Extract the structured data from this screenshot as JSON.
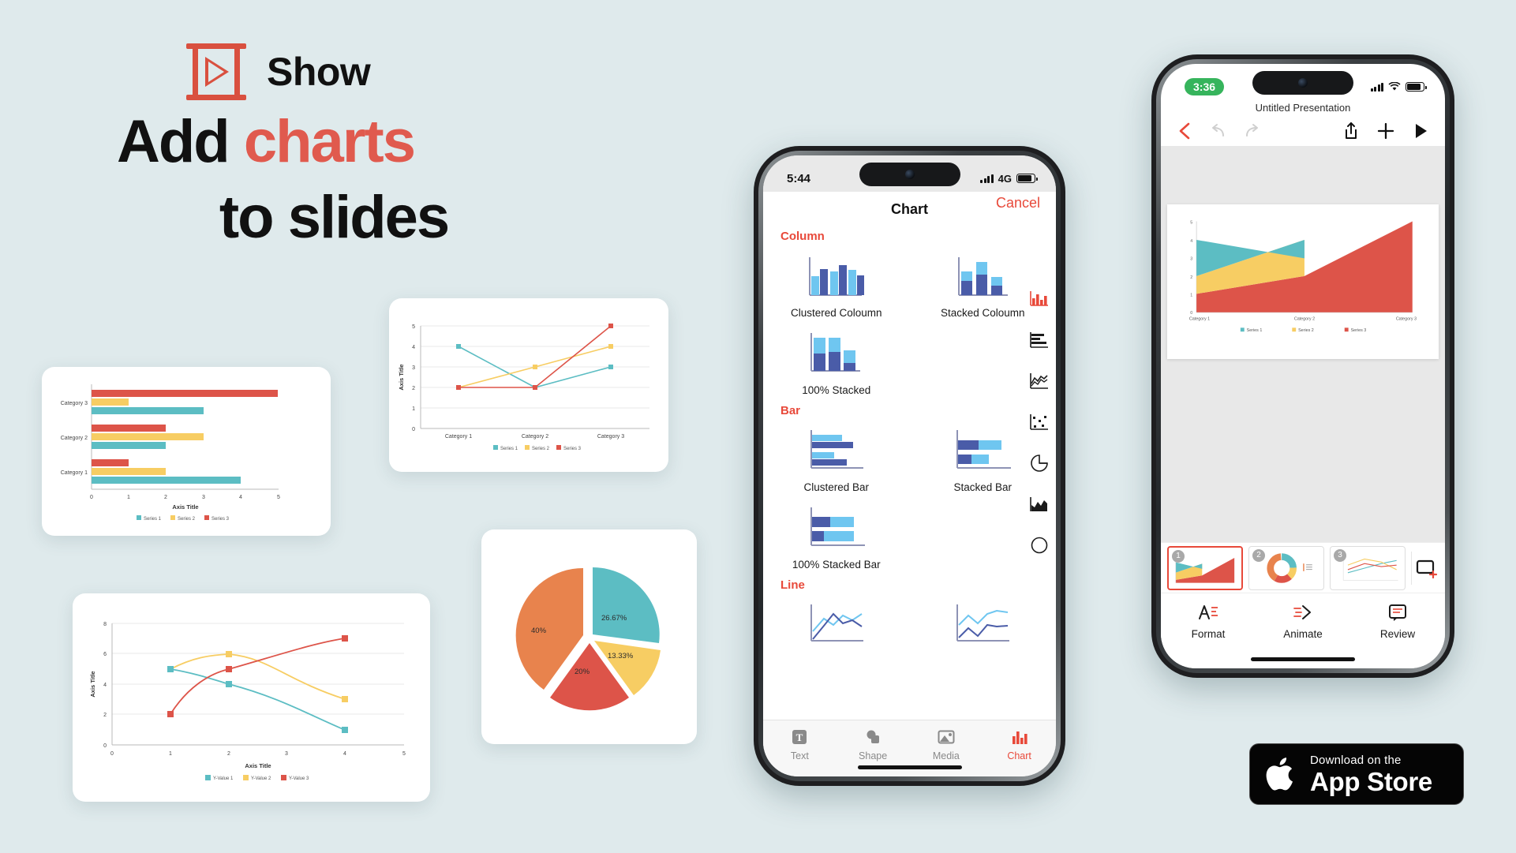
{
  "brand": {
    "name": "Show",
    "logo_icon": "projector-play-icon"
  },
  "headline": {
    "line1_black": "Add ",
    "line1_accent": "charts",
    "line2": "to slides"
  },
  "colors": {
    "accent_red": "#e05a4e",
    "teal": "#5cbdc3",
    "yellow": "#f7cd63",
    "red": "#dd5449",
    "orange": "#e8834d",
    "background": "#dfeaec"
  },
  "chart_data": [
    {
      "id": "clustered-bar-card",
      "type": "bar",
      "orientation": "horizontal",
      "title": "",
      "xlabel": "Axis Title",
      "ylabel": "",
      "categories": [
        "Category 1",
        "Category 2",
        "Category 3"
      ],
      "series": [
        {
          "name": "Series 1",
          "color": "#5cbdc3",
          "values": [
            4,
            2,
            3
          ]
        },
        {
          "name": "Series 2",
          "color": "#f7cd63",
          "values": [
            2,
            3,
            1
          ]
        },
        {
          "name": "Series 3",
          "color": "#dd5449",
          "values": [
            1,
            2,
            5
          ]
        }
      ],
      "xlim": [
        0,
        5
      ],
      "xticks": [
        "0",
        "1",
        "2",
        "3",
        "4",
        "5"
      ],
      "legend": "bottom",
      "grid": false
    },
    {
      "id": "line-card",
      "type": "line",
      "title": "",
      "xlabel": "",
      "ylabel": "Axis Title",
      "categories": [
        "Category 1",
        "Category 2",
        "Category 3"
      ],
      "series": [
        {
          "name": "Series 1",
          "color": "#5cbdc3",
          "values": [
            4,
            2,
            3
          ]
        },
        {
          "name": "Series 2",
          "color": "#f7cd63",
          "values": [
            2,
            3,
            4
          ]
        },
        {
          "name": "Series 3",
          "color": "#dd5449",
          "values": [
            2,
            2,
            5
          ]
        }
      ],
      "ylim": [
        0,
        5
      ],
      "yticks": [
        "0",
        "1",
        "2",
        "3",
        "4",
        "5"
      ],
      "legend": "bottom",
      "grid": true
    },
    {
      "id": "scatter-smooth-card",
      "type": "scatter",
      "title": "",
      "xlabel": "Axis Title",
      "ylabel": "Axis Title",
      "x": [
        1,
        2,
        4
      ],
      "series": [
        {
          "name": "Y-Value 1",
          "color": "#5cbdc3",
          "values": [
            5,
            4,
            1
          ]
        },
        {
          "name": "Y-Value 2",
          "color": "#f7cd63",
          "values": [
            5,
            6,
            3
          ]
        },
        {
          "name": "Y-Value 3",
          "color": "#dd5449",
          "values": [
            2,
            5,
            7
          ]
        }
      ],
      "xlim": [
        0,
        5
      ],
      "ylim": [
        0,
        8
      ],
      "xticks": [
        "0",
        "1",
        "2",
        "3",
        "4",
        "5"
      ],
      "yticks": [
        "0",
        "2",
        "4",
        "6",
        "8"
      ],
      "legend": "bottom",
      "grid": true
    },
    {
      "id": "pie-card",
      "type": "pie",
      "title": "",
      "exploded": true,
      "labels": [
        "26.67%",
        "13.33%",
        "20%",
        "40%"
      ],
      "values": [
        26.67,
        13.33,
        20,
        40
      ],
      "colors": [
        "#5cbdc3",
        "#f7cd63",
        "#dd5449",
        "#e8834d"
      ],
      "legend": "none"
    },
    {
      "id": "phone2-slide-area",
      "type": "area",
      "stacked": true,
      "title": "",
      "xlabel": "",
      "ylabel": "",
      "categories": [
        "Category 1",
        "Category 2",
        "Category 3"
      ],
      "series": [
        {
          "name": "Series 1",
          "color": "#5cbdc3",
          "values": [
            4,
            2.65,
            0
          ]
        },
        {
          "name": "Series 2",
          "color": "#f7cd63",
          "values": [
            2,
            3,
            0
          ]
        },
        {
          "name": "Series 3",
          "color": "#dd5449",
          "values": [
            1,
            2,
            5
          ]
        }
      ],
      "ylim": [
        0,
        5
      ],
      "yticks": [
        "0",
        "1",
        "2",
        "3",
        "4",
        "5"
      ],
      "legend": "bottom",
      "grid": false
    }
  ],
  "phone1": {
    "statusbar": {
      "time": "5:44",
      "network": "4G",
      "signal_icon": "cellular-signal-icon",
      "battery_icon": "battery-icon"
    },
    "header": {
      "title": "Chart",
      "cancel": "Cancel"
    },
    "sections": [
      {
        "title": "Column",
        "options": [
          {
            "label": "Clustered Coloumn",
            "icon": "clustered-column-thumb"
          },
          {
            "label": "Stacked Coloumn",
            "icon": "stacked-column-thumb"
          },
          {
            "label": "100% Stacked",
            "icon": "pct-stacked-column-thumb"
          }
        ]
      },
      {
        "title": "Bar",
        "options": [
          {
            "label": "Clustered Bar",
            "icon": "clustered-bar-thumb"
          },
          {
            "label": "Stacked Bar",
            "icon": "stacked-bar-thumb"
          },
          {
            "label": "100% Stacked Bar",
            "icon": "pct-stacked-bar-thumb"
          }
        ]
      },
      {
        "title": "Line",
        "options": [
          {
            "label": "",
            "icon": "line-thumb"
          },
          {
            "label": "",
            "icon": "line-marker-thumb"
          }
        ]
      }
    ],
    "icon_rail": [
      "column-chart-icon",
      "bar-chart-icon",
      "line-chart-icon",
      "scatter-chart-icon",
      "pie-chart-icon",
      "area-chart-icon",
      "donut-chart-icon"
    ],
    "tabs": [
      {
        "label": "Text",
        "icon": "text-icon",
        "active": false
      },
      {
        "label": "Shape",
        "icon": "shape-icon",
        "active": false
      },
      {
        "label": "Media",
        "icon": "media-icon",
        "active": false
      },
      {
        "label": "Chart",
        "icon": "chart-icon",
        "active": true
      }
    ]
  },
  "phone2": {
    "statusbar": {
      "time": "3:36",
      "recording": true,
      "signal_icon": "cellular-signal-icon",
      "wifi_icon": "wifi-icon",
      "battery_icon": "battery-icon"
    },
    "doc_title": "Untitled Presentation",
    "nav": [
      {
        "name": "back-icon",
        "label": ""
      },
      {
        "name": "undo-icon",
        "label": ""
      },
      {
        "name": "redo-icon",
        "label": ""
      },
      {
        "name": "share-icon",
        "label": ""
      },
      {
        "name": "add-icon",
        "label": ""
      },
      {
        "name": "play-icon",
        "label": ""
      }
    ],
    "slides": [
      {
        "number": "1",
        "type": "area",
        "selected": true
      },
      {
        "number": "2",
        "type": "donut",
        "selected": false
      },
      {
        "number": "3",
        "type": "line",
        "selected": false
      }
    ],
    "add_slide_icon": "add-slide-icon",
    "tabs": [
      {
        "label": "Format",
        "icon": "format-icon"
      },
      {
        "label": "Animate",
        "icon": "animate-icon"
      },
      {
        "label": "Review",
        "icon": "review-icon"
      }
    ]
  },
  "appstore": {
    "small": "Download on the",
    "large": "App Store",
    "icon": "apple-logo-icon"
  }
}
